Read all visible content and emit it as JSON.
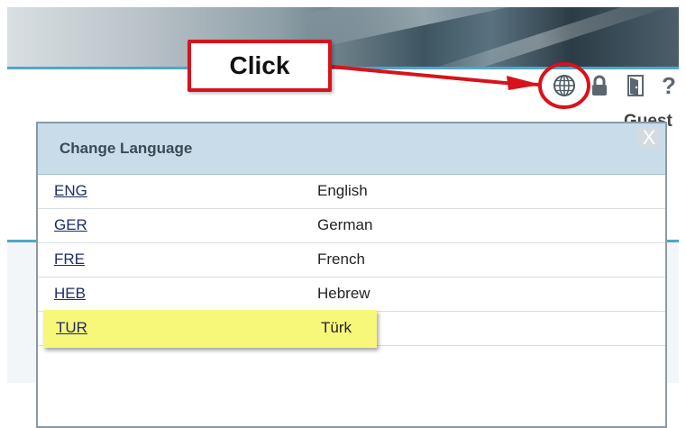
{
  "header": {
    "icons": [
      "globe-icon",
      "lock-icon",
      "logout-door-icon",
      "help-icon"
    ],
    "help_glyph": "?",
    "user_label": "Guest"
  },
  "callout": {
    "text": "Click"
  },
  "dialog": {
    "title": "Change Language",
    "close_glyph": "X",
    "languages": [
      {
        "code": "ENG",
        "name": "English"
      },
      {
        "code": "GER",
        "name": "German"
      },
      {
        "code": "FRE",
        "name": "French"
      },
      {
        "code": "HEB",
        "name": "Hebrew"
      },
      {
        "code": "TUR",
        "name": "Türk"
      }
    ]
  },
  "colors": {
    "accent_blue": "#4fa5cc",
    "callout_red": "#d8121b",
    "highlight_yellow": "#f7f87a",
    "dialog_header": "#c9dcea"
  }
}
